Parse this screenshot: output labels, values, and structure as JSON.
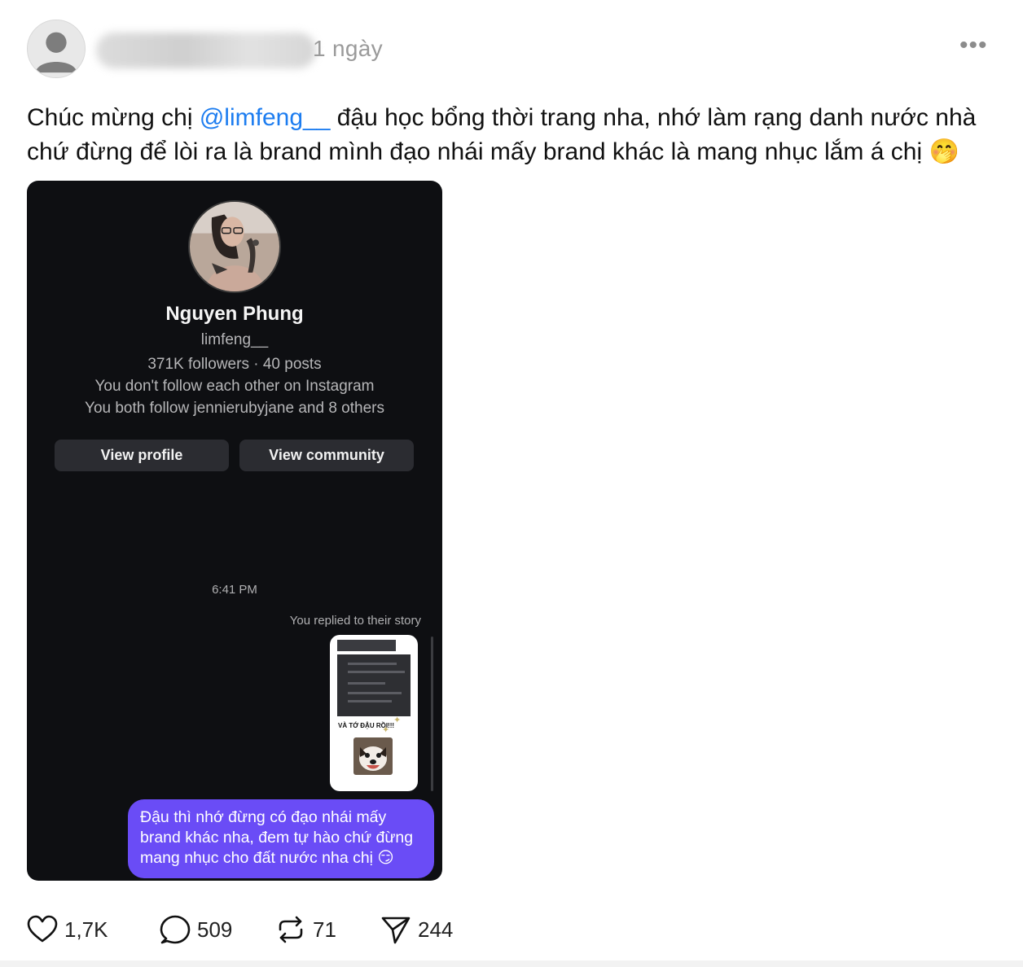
{
  "post": {
    "time": "1 ngày",
    "more_label": "•••",
    "text_before": "Chúc mừng chị ",
    "mention": "@limfeng__",
    "text_after": " đậu học bổng thời trang nha, nhớ làm rạng danh nước nhà chứ đừng để lòi ra là brand mình đạo nhái mấy brand khác là mang nhục lắm á chị 🤭"
  },
  "screenshot": {
    "name": "Nguyen Phung",
    "handle": "limfeng__",
    "stats": "371K followers · 40 posts",
    "follow_status": "You don't follow each other on Instagram",
    "mutual": "You both follow jennierubyjane and 8 others",
    "view_profile": "View profile",
    "view_community": "View community",
    "message_time": "6:41 PM",
    "replied_label": "You replied to their story",
    "story_caption": "VÀ TỚ ĐẬU RỒI!!!",
    "message": "Đậu thì nhớ đừng có đạo nhái mấy brand khác nha, đem tự hào chứ đừng mang nhục cho đất nước nha chị 😏"
  },
  "actions": {
    "likes": "1,7K",
    "comments": "509",
    "reposts": "71",
    "shares": "244"
  },
  "colors": {
    "mention": "#1d7df0",
    "bubble": "#6a4cf6",
    "dark_bg": "#0e0f12"
  }
}
